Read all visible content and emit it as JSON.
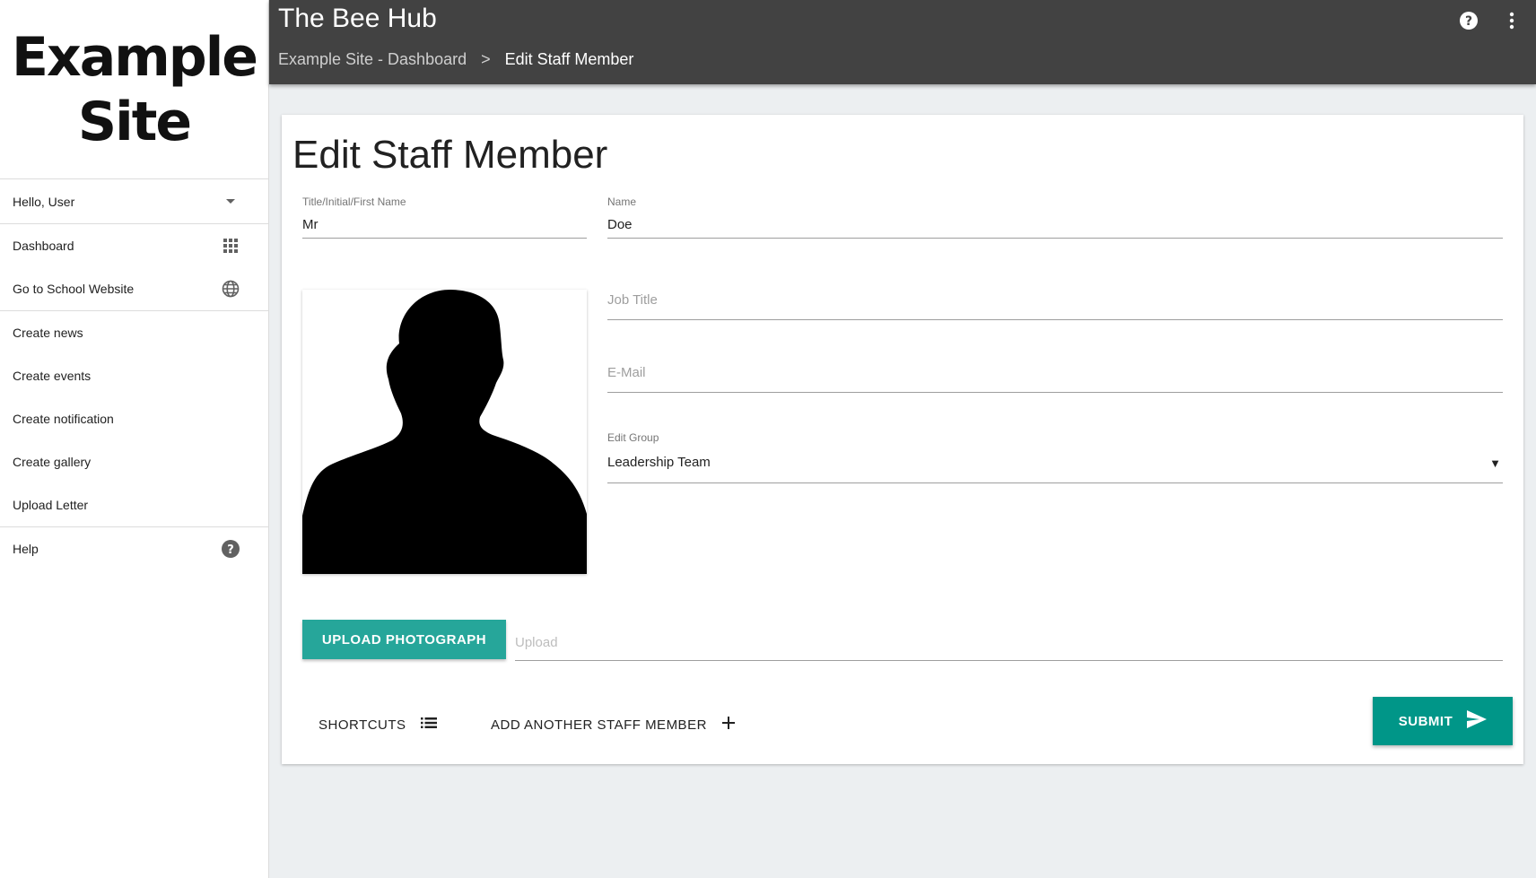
{
  "sidebar": {
    "logo_line1": "Example",
    "logo_line2": "Site",
    "user_menu": "Hello, User",
    "items": [
      {
        "label": "Dashboard",
        "icon": "apps-grid-icon"
      },
      {
        "label": "Go to School Website",
        "icon": "globe-icon"
      },
      {
        "label": "Create news"
      },
      {
        "label": "Create events"
      },
      {
        "label": "Create notification"
      },
      {
        "label": "Create gallery"
      },
      {
        "label": "Upload Letter"
      },
      {
        "label": "Help",
        "icon": "help-circle-icon"
      }
    ]
  },
  "topbar": {
    "title": "The Bee Hub",
    "icons": [
      "help-circle-icon",
      "more-vertical-icon"
    ],
    "breadcrumb": {
      "parent": "Example Site - Dashboard",
      "separator": ">",
      "current": "Edit Staff Member"
    }
  },
  "form": {
    "page_title": "Edit Staff Member",
    "first_name": {
      "label": "Title/Initial/First Name",
      "value": "Mr"
    },
    "name": {
      "label": "Name",
      "value": "Doe"
    },
    "job_title": {
      "placeholder": "Job Title"
    },
    "email": {
      "placeholder": "E-Mail"
    },
    "edit_group": {
      "label": "Edit Group",
      "value": "Leadership Team",
      "arrow": "▼"
    },
    "photo": {
      "icon": "person-silhouette-icon"
    },
    "upload_button": "UPLOAD PHOTOGRAPH",
    "upload_placeholder": "Upload",
    "shortcuts_button": "SHORTCUTS",
    "add_staff_button": "ADD ANOTHER STAFF MEMBER",
    "submit_button": "SUBMIT"
  },
  "colors": {
    "topbar": "#424242",
    "background": "#eceff1",
    "upload_button": "#26a69a",
    "submit_button": "#009688"
  }
}
